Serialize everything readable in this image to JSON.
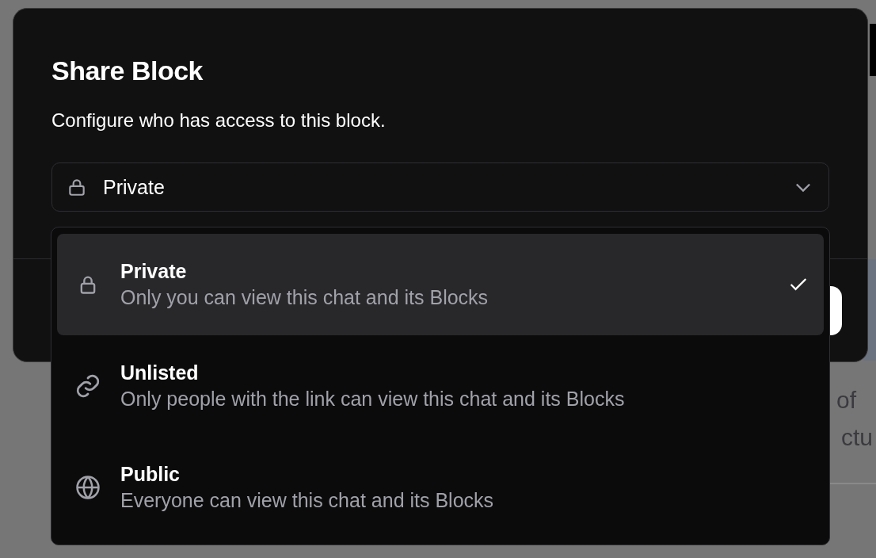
{
  "background": {
    "texts": [
      "of",
      "ctu"
    ]
  },
  "dialog": {
    "title": "Share Block",
    "description": "Configure who has access to this block.",
    "select": {
      "value": "Private",
      "expanded": true
    },
    "options": [
      {
        "kind": "lock",
        "label": "Private",
        "description": "Only you can view this chat and its Blocks",
        "selected": true
      },
      {
        "kind": "link",
        "label": "Unlisted",
        "description": "Only people with the link can view this chat and its Blocks",
        "selected": false
      },
      {
        "kind": "globe",
        "label": "Public",
        "description": "Everyone can view this chat and its Blocks",
        "selected": false
      }
    ]
  }
}
